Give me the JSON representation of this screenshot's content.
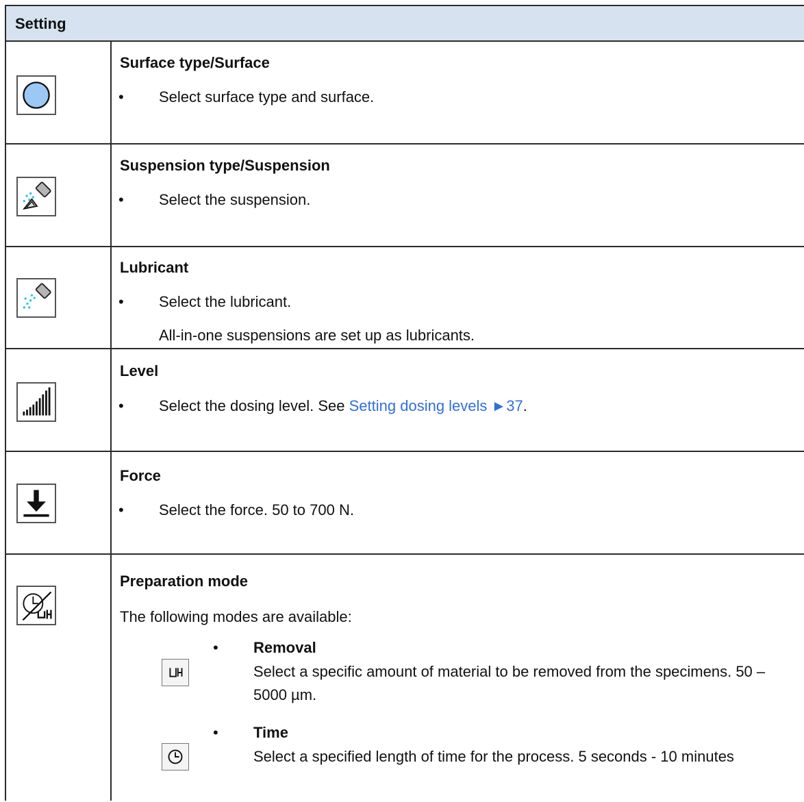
{
  "header": {
    "title": "Setting"
  },
  "rows": [
    {
      "icon": "circle-surface-icon",
      "title": "Surface type/Surface",
      "bullet": "•",
      "text": "Select surface type and surface."
    },
    {
      "icon": "suspension-spray-icon",
      "title": "Suspension type/Suspension",
      "bullet": "•",
      "text": "Select the suspension."
    },
    {
      "icon": "lubricant-spray-icon",
      "title": "Lubricant",
      "bullet": "•",
      "text": "Select the lubricant.",
      "note": "All-in-one suspensions are set up as lubricants."
    },
    {
      "icon": "level-bars-icon",
      "title": "Level",
      "bullet": "•",
      "text": "Select the dosing level. See ",
      "link": "Setting dosing levels ►37",
      "after": "."
    },
    {
      "icon": "force-down-arrow-icon",
      "title": "Force",
      "bullet": "•",
      "text": "Select the force. 50 to 700 N."
    },
    {
      "icon": "preparation-mode-icon",
      "title": "Preparation mode",
      "intro": "The following modes are available:",
      "modes": [
        {
          "icon": "removal-icon",
          "bullet": "•",
          "title": "Removal",
          "text": "Select a specific amount of material to be removed from the specimens. 50 – 5000 µm."
        },
        {
          "icon": "clock-icon",
          "bullet": "•",
          "title": "Time",
          "text": "Select a specified length of time for the process. 5 seconds - 10 minutes"
        }
      ]
    }
  ]
}
